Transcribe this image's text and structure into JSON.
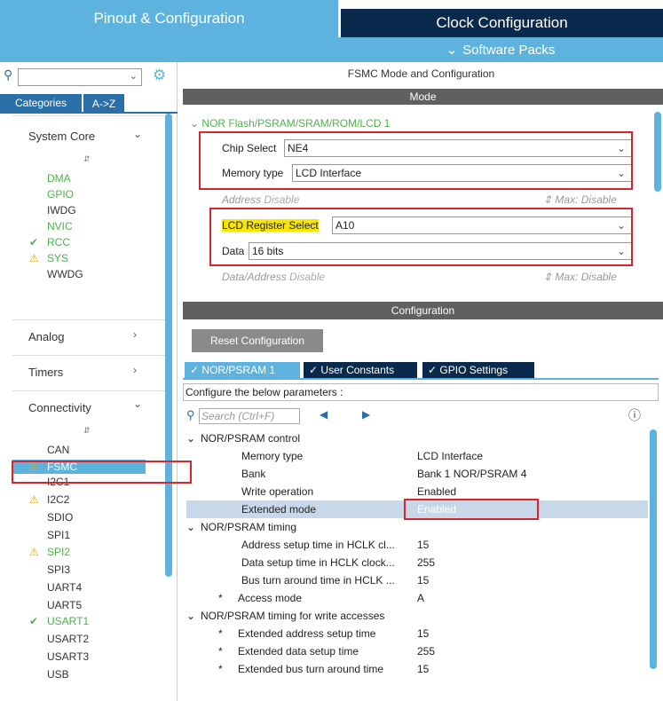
{
  "top_tabs": {
    "pinout": "Pinout & Configuration",
    "clock": "Clock Configuration"
  },
  "software_packs": "Software Packs",
  "left": {
    "categories_tab": "Categories",
    "az_tab": "A->Z",
    "groups": {
      "system_core": "System Core",
      "analog": "Analog",
      "timers": "Timers",
      "connectivity": "Connectivity"
    },
    "system_core_items": [
      "DMA",
      "GPIO",
      "IWDG",
      "NVIC",
      "RCC",
      "SYS",
      "WWDG"
    ],
    "connectivity_items": [
      "CAN",
      "FSMC",
      "I2C1",
      "I2C2",
      "SDIO",
      "SPI1",
      "SPI2",
      "SPI3",
      "UART4",
      "UART5",
      "USART1",
      "USART2",
      "USART3",
      "USB"
    ]
  },
  "right": {
    "title": "FSMC Mode and Configuration",
    "mode_bar": "Mode",
    "nor_section": "NOR Flash/PSRAM/SRAM/ROM/LCD 1",
    "chip_select_label": "Chip Select",
    "chip_select_value": "NE4",
    "memory_type_label": "Memory type",
    "memory_type_value": "LCD Interface",
    "address_label": "Address",
    "address_value": "Disable",
    "max_disable": "Max: Disable",
    "lcd_reg_label": "LCD Register Select",
    "lcd_reg_value": "A10",
    "data_label": "Data",
    "data_value": "16 bits",
    "data_address_label": "Data/Address",
    "data_address_value": "Disable",
    "config_bar": "Configuration",
    "reset_button": "Reset Configuration",
    "tabs": [
      "NOR/PSRAM 1",
      "User Constants",
      "GPIO Settings"
    ],
    "configure_text": "Configure the below parameters :",
    "search_placeholder": "Search (Ctrl+F)",
    "params": {
      "control_header": "NOR/PSRAM control",
      "memory_type": [
        "Memory type",
        "LCD Interface"
      ],
      "bank": [
        "Bank",
        "Bank 1 NOR/PSRAM 4"
      ],
      "write_operation": [
        "Write operation",
        "Enabled"
      ],
      "extended_mode": [
        "Extended mode",
        "Enabled"
      ],
      "timing_header": "NOR/PSRAM timing",
      "addr_setup": [
        "Address setup time in HCLK cl...",
        "15"
      ],
      "data_setup": [
        "Data setup time in HCLK clock...",
        "255"
      ],
      "bus_turn": [
        "Bus turn around time in HCLK ...",
        "15"
      ],
      "access_mode": [
        "Access mode",
        "A"
      ],
      "write_timing_header": "NOR/PSRAM timing for write accesses",
      "ext_addr_setup": [
        "Extended address setup time",
        "15"
      ],
      "ext_data_setup": [
        "Extended data setup time",
        "255"
      ],
      "ext_bus_turn": [
        "Extended bus turn around time",
        "15"
      ]
    }
  }
}
